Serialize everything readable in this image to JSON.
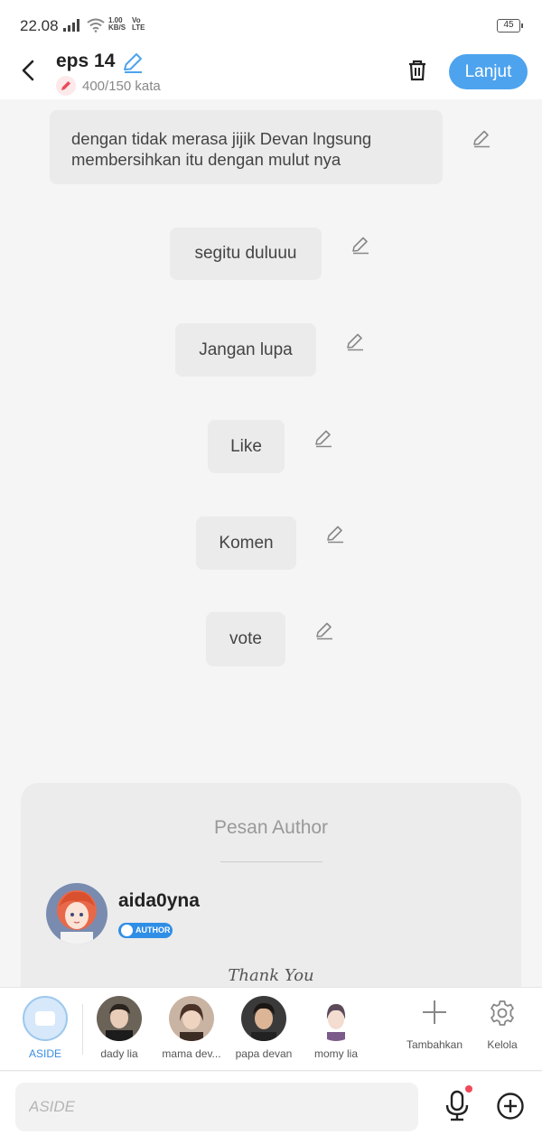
{
  "status_bar": {
    "time": "22.08",
    "net_speed_top": "1.00",
    "net_speed_bottom": "KB/S",
    "volte_top": "Vo",
    "volte_bottom": "LTE",
    "battery": "45"
  },
  "header": {
    "title": "eps 14",
    "word_count": "400/150 kata",
    "next_label": "Lanjut",
    "accent_color": "#4da3ee"
  },
  "messages": [
    "dengan tidak merasa jijik Devan lngsung membersihkan itu dengan mulut nya",
    "segitu duluuu",
    "Jangan lupa",
    "Like",
    "Komen",
    "vote"
  ],
  "author_card": {
    "heading": "Pesan Author",
    "username": "aida0yna",
    "badge": "AUTHOR",
    "message": "Thank You"
  },
  "characters": {
    "aside_label": "ASIDE",
    "items": [
      {
        "name": "dady lia"
      },
      {
        "name": "mama dev..."
      },
      {
        "name": "papa devan"
      },
      {
        "name": "momy lia"
      }
    ],
    "add_label": "Tambahkan",
    "manage_label": "Kelola"
  },
  "composer": {
    "placeholder": "ASIDE"
  }
}
